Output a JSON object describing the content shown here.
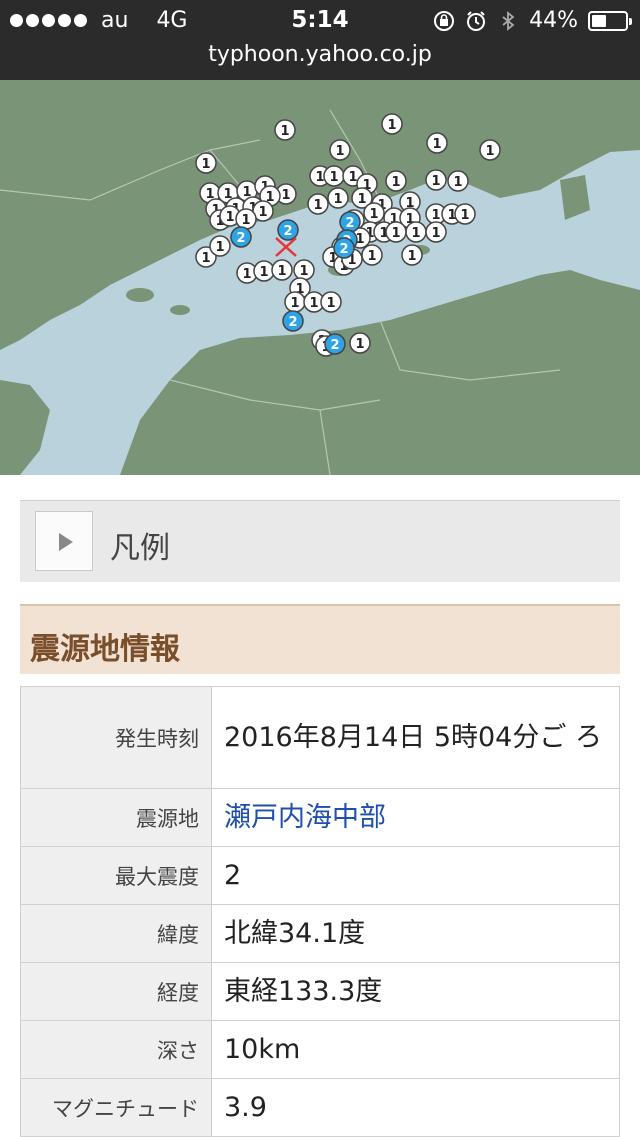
{
  "status_bar": {
    "carrier": "au",
    "network": "4G",
    "time": "5:14",
    "battery_percent": "44%",
    "battery_level": 0.44,
    "icons": [
      "rotation-lock-icon",
      "alarm-icon",
      "bluetooth-icon",
      "battery-icon"
    ]
  },
  "browser": {
    "url": "typhoon.yahoo.co.jp"
  },
  "map": {
    "epicenter_marker": "×",
    "colors": {
      "sea": "#b9d2dc",
      "land": "#7a9477",
      "intensity1": "#ffffff",
      "intensity2": "#2ea3e6"
    },
    "intensity_markers": [
      "1",
      "2"
    ]
  },
  "legend": {
    "label": "凡例"
  },
  "section": {
    "title": "震源地情報"
  },
  "table": {
    "rows": [
      {
        "key": "発生時刻",
        "value": "2016年8月14日 5時04分ご ろ"
      },
      {
        "key": "震源地",
        "value": "瀬戸内海中部"
      },
      {
        "key": "最大震度",
        "value": "2"
      },
      {
        "key": "緯度",
        "value": "北緯34.1度"
      },
      {
        "key": "経度",
        "value": "東経133.3度"
      },
      {
        "key": "深さ",
        "value": "10km"
      },
      {
        "key": "マグニチュード",
        "value": "3.9"
      }
    ]
  }
}
